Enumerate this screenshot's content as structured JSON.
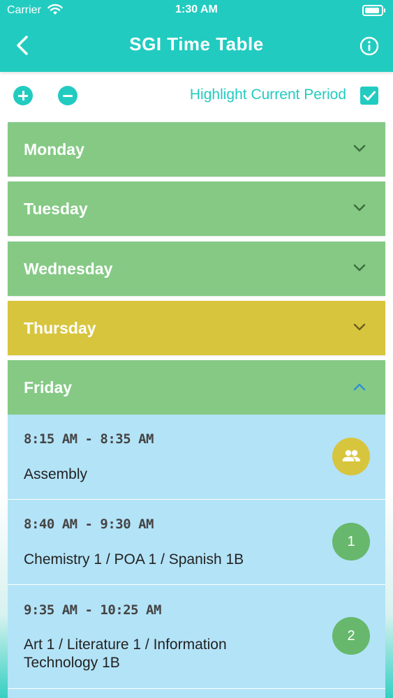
{
  "status_bar": {
    "carrier": "Carrier",
    "time": "1:30 AM"
  },
  "nav": {
    "title": "SGI Time Table",
    "back_icon": "chevron-left-icon",
    "info_icon": "info-icon"
  },
  "toolbar": {
    "add_icon": "plus-circle-icon",
    "remove_icon": "minus-circle-icon",
    "highlight_label": "Highlight Current Period",
    "highlight_checked": true
  },
  "days": [
    {
      "label": "Monday",
      "expanded": false,
      "current": false
    },
    {
      "label": "Tuesday",
      "expanded": false,
      "current": false
    },
    {
      "label": "Wednesday",
      "expanded": false,
      "current": false
    },
    {
      "label": "Thursday",
      "expanded": false,
      "current": true
    },
    {
      "label": "Friday",
      "expanded": true,
      "current": false
    }
  ],
  "friday_periods": [
    {
      "time": "8:15 AM - 8:35 AM",
      "subject": "Assembly",
      "badge_icon": "group-icon"
    },
    {
      "time": "8:40 AM - 9:30 AM",
      "subject": "Chemistry 1 / POA 1 / Spanish 1B",
      "badge": "1"
    },
    {
      "time": "9:35 AM - 10:25 AM",
      "subject": "Art 1 / Literature 1 / Information Technology 1B",
      "badge": "2"
    }
  ],
  "colors": {
    "accent": "#22cbc0",
    "day_default": "#85c985",
    "day_current": "#d8c53e",
    "period_bg": "#b3e3f7",
    "badge_green": "#67b86c",
    "badge_yellow": "#d8c53e",
    "chevron_collapsed": "#3a6e3a",
    "chevron_expanded": "#2f8fd6"
  }
}
